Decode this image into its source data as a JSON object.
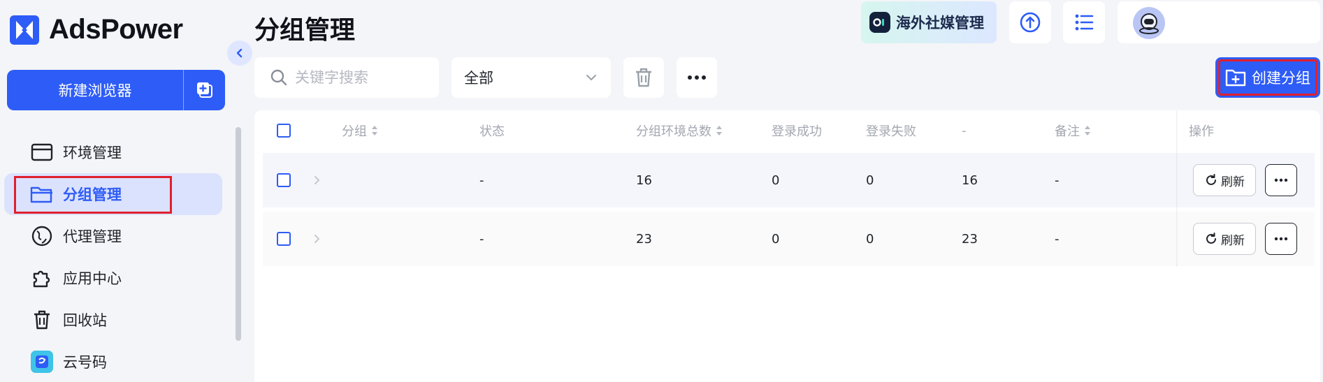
{
  "brand": {
    "name": "AdsPower",
    "color": "#2e5cf6"
  },
  "sidebar": {
    "new_browser_label": "新建浏览器",
    "items": [
      {
        "label": "环境管理",
        "icon": "browser-window-icon"
      },
      {
        "label": "分组管理",
        "icon": "folder-icon",
        "active": true
      },
      {
        "label": "代理管理",
        "icon": "proxy-globe-icon"
      },
      {
        "label": "应用中心",
        "icon": "puzzle-icon"
      },
      {
        "label": "回收站",
        "icon": "trash-icon"
      },
      {
        "label": "云号码",
        "icon": "cloud-number-icon"
      }
    ]
  },
  "header": {
    "title": "分组管理",
    "promo_label": "海外社媒管理"
  },
  "toolbar": {
    "search_placeholder": "关键字搜索",
    "filter_value": "全部",
    "create_label": "创建分组"
  },
  "table": {
    "columns": [
      "分组",
      "状态",
      "分组环境总数",
      "登录成功",
      "登录失败",
      "-",
      "备注",
      "操作"
    ],
    "rows": [
      {
        "group": "",
        "status": "-",
        "total": "16",
        "success": "0",
        "fail": "0",
        "dash": "16",
        "note": "-"
      },
      {
        "group": "",
        "status": "-",
        "total": "23",
        "success": "0",
        "fail": "0",
        "dash": "23",
        "note": "-"
      }
    ],
    "refresh_label": "刷新"
  },
  "colors": {
    "accent": "#2e5cf6",
    "highlight_border": "#e0202e",
    "active_bg": "#dbe2fd"
  }
}
